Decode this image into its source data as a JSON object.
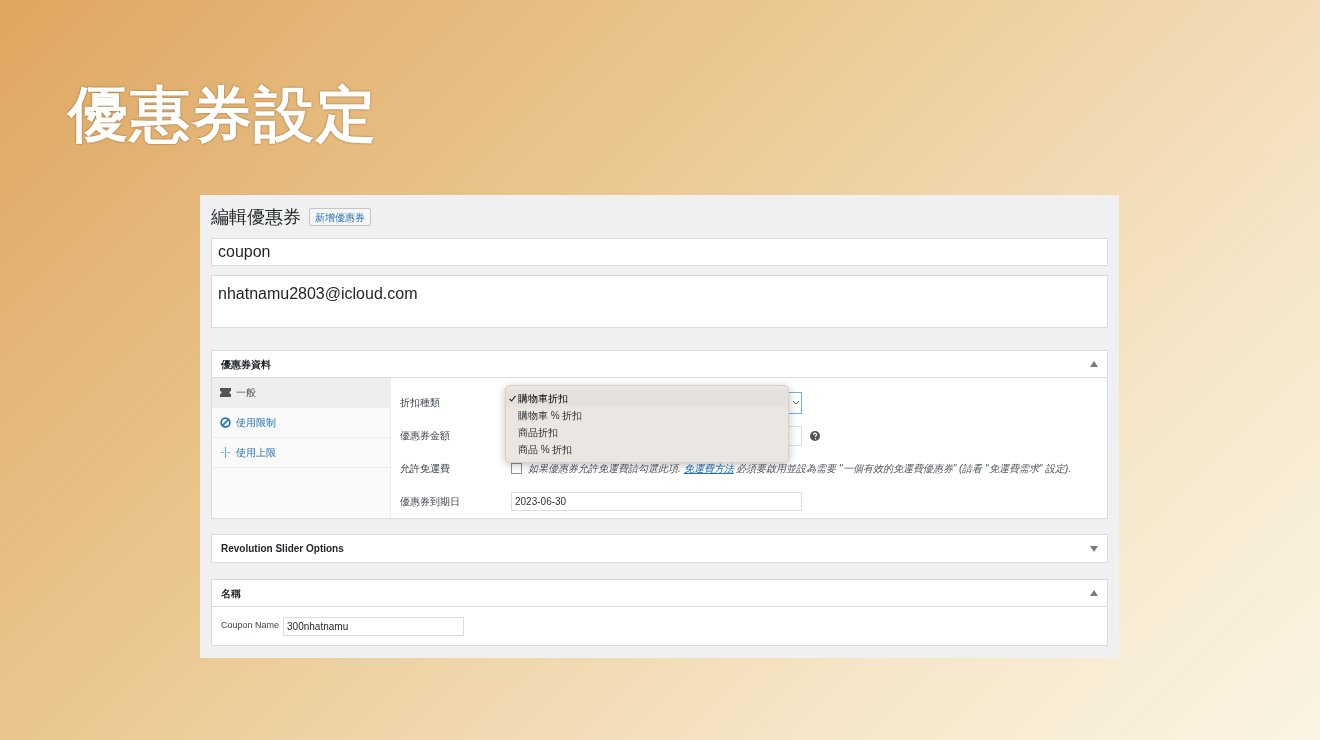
{
  "slide_title": "優惠券設定",
  "page": {
    "heading": "編輯優惠券",
    "add_button": "新增優惠券",
    "title_value": "coupon",
    "description_value": "nhatnamu2803@icloud.com"
  },
  "coupon_data": {
    "title": "優惠券資料",
    "expanded": true,
    "tabs": [
      {
        "label": "一般",
        "selected": true
      },
      {
        "label": "使用限制",
        "selected": false
      },
      {
        "label": "使用上限",
        "selected": false
      }
    ],
    "fields": [
      {
        "kind": "select",
        "label": "折扣種類"
      },
      {
        "kind": "amount",
        "label": "優惠券金額"
      },
      {
        "kind": "checkbox",
        "label": "允許免運費",
        "checked": false,
        "text_before": "如果優惠券允許免運費請勾選此項.",
        "link": "免運費方法",
        "text_after": "必須要啟用並設為需要 \"一個有效的免運費優惠券\" (請看 \"免運費需求\" 設定)."
      },
      {
        "kind": "date",
        "label": "優惠券到期日",
        "value": "2023-06-30"
      }
    ],
    "dropdown_options": [
      {
        "label": "購物車折扣",
        "selected": true
      },
      {
        "label": "購物車 % 折扣",
        "selected": false
      },
      {
        "label": "商品折扣",
        "selected": false
      },
      {
        "label": "商品 % 折扣",
        "selected": false
      }
    ]
  },
  "boxes": [
    {
      "title": "Revolution Slider Options",
      "expanded": false
    },
    {
      "title": "名稱",
      "expanded": true,
      "field_label": "Coupon Name",
      "field_value": "300nhatnamu"
    }
  ]
}
